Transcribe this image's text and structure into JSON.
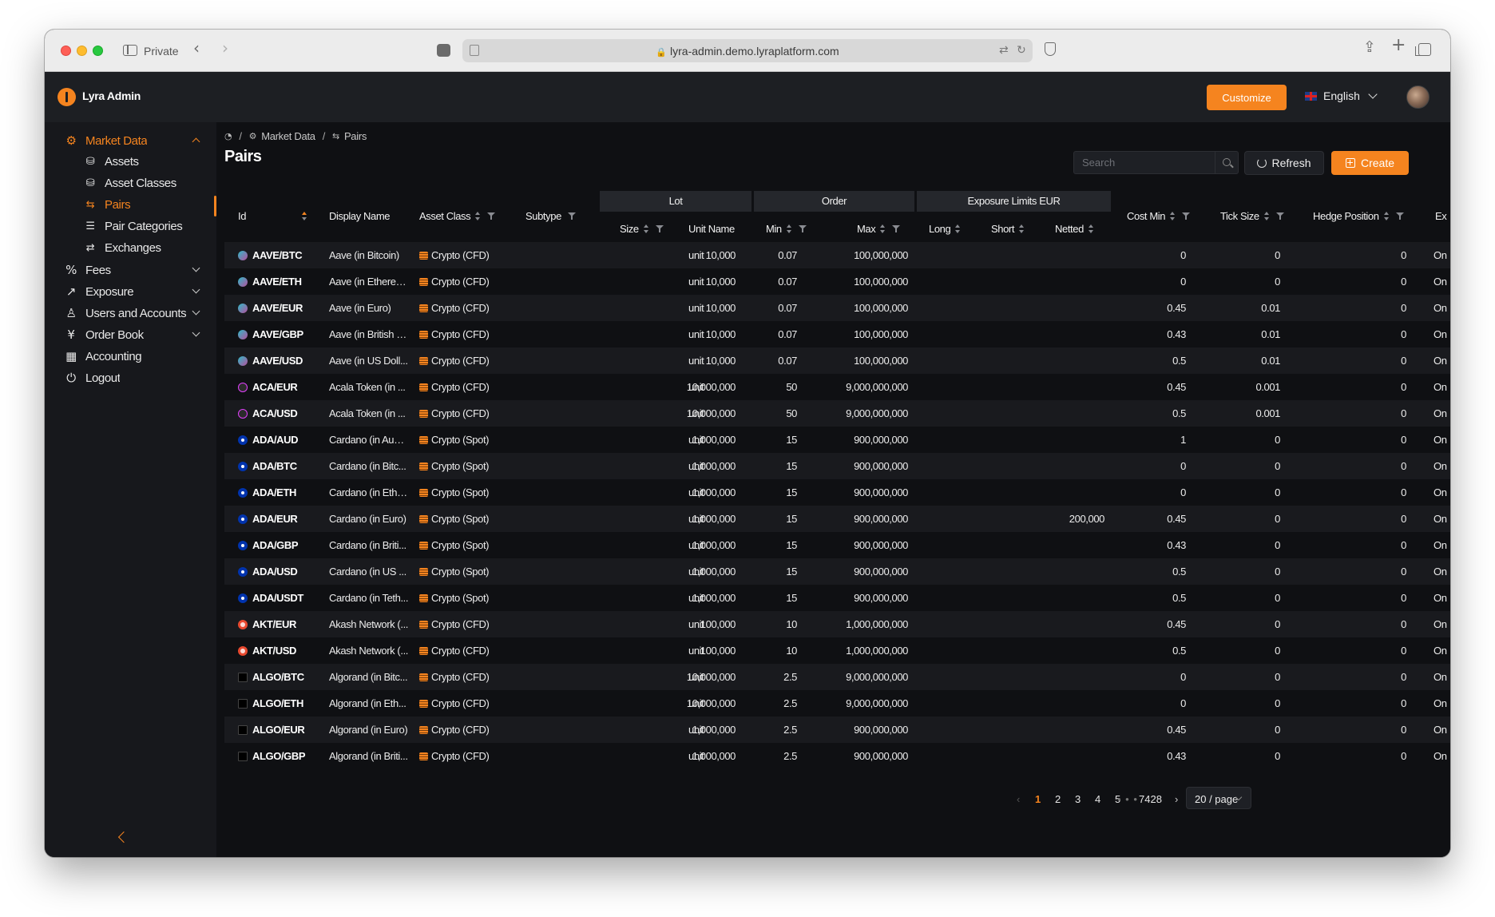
{
  "browser": {
    "private_label": "Private",
    "url": "lyra-admin.demo.lyraplatform.com"
  },
  "header": {
    "brand": "Lyra Admin",
    "customize_label": "Customize",
    "language": "English",
    "accent_color": "#f5841f"
  },
  "sidebar": {
    "items": [
      {
        "label": "Market Data",
        "icon": "gear-icon",
        "expanded": true
      },
      {
        "label": "Assets",
        "icon": "assets-icon"
      },
      {
        "label": "Asset Classes",
        "icon": "asset-classes-icon"
      },
      {
        "label": "Pairs",
        "icon": "swap-icon"
      },
      {
        "label": "Pair Categories",
        "icon": "list-icon"
      },
      {
        "label": "Exchanges",
        "icon": "exchange-icon"
      },
      {
        "label": "Fees",
        "icon": "percent-icon"
      },
      {
        "label": "Exposure",
        "icon": "trend-icon"
      },
      {
        "label": "Users and Accounts",
        "icon": "user-icon"
      },
      {
        "label": "Order Book",
        "icon": "yen-icon"
      },
      {
        "label": "Accounting",
        "icon": "calculator-icon"
      },
      {
        "label": "Logout",
        "icon": "logout-icon"
      }
    ]
  },
  "breadcrumb": {
    "items": [
      "Market Data",
      "Pairs"
    ]
  },
  "page": {
    "title": "Pairs",
    "search_placeholder": "Search",
    "refresh_label": "Refresh",
    "create_label": "Create"
  },
  "table": {
    "group_headers": {
      "lot": "Lot",
      "order": "Order",
      "exposure": "Exposure Limits EUR"
    },
    "columns": {
      "id": "Id",
      "display_name": "Display Name",
      "asset_class": "Asset Class",
      "subtype": "Subtype",
      "lot_size": "Size",
      "unit_name": "Unit Name",
      "order_min": "Min",
      "order_max": "Max",
      "long": "Long",
      "short": "Short",
      "netted": "Netted",
      "cost_min": "Cost Min",
      "tick_size": "Tick Size",
      "hedge_position": "Hedge Position",
      "ex": "Ex"
    },
    "rows": [
      {
        "id": "AAVE/BTC",
        "coin": "aave",
        "name": "Aave (in Bitcoin)",
        "asset_class": "Crypto (CFD)",
        "size": "10,000",
        "unit": "unit",
        "min": "0.07",
        "max": "100,000,000",
        "netted": "",
        "cost_min": "0",
        "tick": "0",
        "hedge": "0",
        "ex": "On"
      },
      {
        "id": "AAVE/ETH",
        "coin": "aave",
        "name": "Aave (in Ethereu...",
        "asset_class": "Crypto (CFD)",
        "size": "10,000",
        "unit": "unit",
        "min": "0.07",
        "max": "100,000,000",
        "netted": "",
        "cost_min": "0",
        "tick": "0",
        "hedge": "0",
        "ex": "On"
      },
      {
        "id": "AAVE/EUR",
        "coin": "aave",
        "name": "Aave (in Euro)",
        "asset_class": "Crypto (CFD)",
        "size": "10,000",
        "unit": "unit",
        "min": "0.07",
        "max": "100,000,000",
        "netted": "",
        "cost_min": "0.45",
        "tick": "0.01",
        "hedge": "0",
        "ex": "On"
      },
      {
        "id": "AAVE/GBP",
        "coin": "aave",
        "name": "Aave (in British P...",
        "asset_class": "Crypto (CFD)",
        "size": "10,000",
        "unit": "unit",
        "min": "0.07",
        "max": "100,000,000",
        "netted": "",
        "cost_min": "0.43",
        "tick": "0.01",
        "hedge": "0",
        "ex": "On"
      },
      {
        "id": "AAVE/USD",
        "coin": "aave",
        "name": "Aave (in US Doll...",
        "asset_class": "Crypto (CFD)",
        "size": "10,000",
        "unit": "unit",
        "min": "0.07",
        "max": "100,000,000",
        "netted": "",
        "cost_min": "0.5",
        "tick": "0.01",
        "hedge": "0",
        "ex": "On"
      },
      {
        "id": "ACA/EUR",
        "coin": "aca",
        "name": "Acala Token (in ...",
        "asset_class": "Crypto (CFD)",
        "size": "10,000,000",
        "unit": "unit",
        "min": "50",
        "max": "9,000,000,000",
        "netted": "",
        "cost_min": "0.45",
        "tick": "0.001",
        "hedge": "0",
        "ex": "On"
      },
      {
        "id": "ACA/USD",
        "coin": "aca",
        "name": "Acala Token (in ...",
        "asset_class": "Crypto (CFD)",
        "size": "10,000,000",
        "unit": "unit",
        "min": "50",
        "max": "9,000,000,000",
        "netted": "",
        "cost_min": "0.5",
        "tick": "0.001",
        "hedge": "0",
        "ex": "On"
      },
      {
        "id": "ADA/AUD",
        "coin": "ada",
        "name": "Cardano (in Aust...",
        "asset_class": "Crypto (Spot)",
        "size": "1,000,000",
        "unit": "unit",
        "min": "15",
        "max": "900,000,000",
        "netted": "",
        "cost_min": "1",
        "tick": "0",
        "hedge": "0",
        "ex": "On"
      },
      {
        "id": "ADA/BTC",
        "coin": "ada",
        "name": "Cardano (in Bitc...",
        "asset_class": "Crypto (Spot)",
        "size": "1,000,000",
        "unit": "unit",
        "min": "15",
        "max": "900,000,000",
        "netted": "",
        "cost_min": "0",
        "tick": "0",
        "hedge": "0",
        "ex": "On"
      },
      {
        "id": "ADA/ETH",
        "coin": "ada",
        "name": "Cardano (in Ethe...",
        "asset_class": "Crypto (Spot)",
        "size": "1,000,000",
        "unit": "unit",
        "min": "15",
        "max": "900,000,000",
        "netted": "",
        "cost_min": "0",
        "tick": "0",
        "hedge": "0",
        "ex": "On"
      },
      {
        "id": "ADA/EUR",
        "coin": "ada",
        "name": "Cardano (in Euro)",
        "asset_class": "Crypto (Spot)",
        "size": "1,000,000",
        "unit": "unit",
        "min": "15",
        "max": "900,000,000",
        "netted": "200,000",
        "cost_min": "0.45",
        "tick": "0",
        "hedge": "0",
        "ex": "On"
      },
      {
        "id": "ADA/GBP",
        "coin": "ada",
        "name": "Cardano (in Briti...",
        "asset_class": "Crypto (Spot)",
        "size": "1,000,000",
        "unit": "unit",
        "min": "15",
        "max": "900,000,000",
        "netted": "",
        "cost_min": "0.43",
        "tick": "0",
        "hedge": "0",
        "ex": "On"
      },
      {
        "id": "ADA/USD",
        "coin": "ada",
        "name": "Cardano (in US ...",
        "asset_class": "Crypto (Spot)",
        "size": "1,000,000",
        "unit": "unit",
        "min": "15",
        "max": "900,000,000",
        "netted": "",
        "cost_min": "0.5",
        "tick": "0",
        "hedge": "0",
        "ex": "On"
      },
      {
        "id": "ADA/USDT",
        "coin": "ada",
        "name": "Cardano (in Teth...",
        "asset_class": "Crypto (Spot)",
        "size": "1,000,000",
        "unit": "unit",
        "min": "15",
        "max": "900,000,000",
        "netted": "",
        "cost_min": "0.5",
        "tick": "0",
        "hedge": "0",
        "ex": "On"
      },
      {
        "id": "AKT/EUR",
        "coin": "akt",
        "name": "Akash Network (...",
        "asset_class": "Crypto (CFD)",
        "size": "100,000",
        "unit": "unit",
        "min": "10",
        "max": "1,000,000,000",
        "netted": "",
        "cost_min": "0.45",
        "tick": "0",
        "hedge": "0",
        "ex": "On"
      },
      {
        "id": "AKT/USD",
        "coin": "akt",
        "name": "Akash Network (...",
        "asset_class": "Crypto (CFD)",
        "size": "100,000",
        "unit": "unit",
        "min": "10",
        "max": "1,000,000,000",
        "netted": "",
        "cost_min": "0.5",
        "tick": "0",
        "hedge": "0",
        "ex": "On"
      },
      {
        "id": "ALGO/BTC",
        "coin": "algo",
        "name": "Algorand (in Bitc...",
        "asset_class": "Crypto (CFD)",
        "size": "10,000,000",
        "unit": "unit",
        "min": "2.5",
        "max": "9,000,000,000",
        "netted": "",
        "cost_min": "0",
        "tick": "0",
        "hedge": "0",
        "ex": "On"
      },
      {
        "id": "ALGO/ETH",
        "coin": "algo",
        "name": "Algorand (in Eth...",
        "asset_class": "Crypto (CFD)",
        "size": "10,000,000",
        "unit": "unit",
        "min": "2.5",
        "max": "9,000,000,000",
        "netted": "",
        "cost_min": "0",
        "tick": "0",
        "hedge": "0",
        "ex": "On"
      },
      {
        "id": "ALGO/EUR",
        "coin": "algo",
        "name": "Algorand (in Euro)",
        "asset_class": "Crypto (CFD)",
        "size": "1,000,000",
        "unit": "unit",
        "min": "2.5",
        "max": "900,000,000",
        "netted": "",
        "cost_min": "0.45",
        "tick": "0",
        "hedge": "0",
        "ex": "On"
      },
      {
        "id": "ALGO/GBP",
        "coin": "algo",
        "name": "Algorand (in Briti...",
        "asset_class": "Crypto (CFD)",
        "size": "1,000,000",
        "unit": "unit",
        "min": "2.5",
        "max": "900,000,000",
        "netted": "",
        "cost_min": "0.43",
        "tick": "0",
        "hedge": "0",
        "ex": "On"
      }
    ]
  },
  "pagination": {
    "pages": [
      "1",
      "2",
      "3",
      "4",
      "5"
    ],
    "current": "1",
    "ellipsis": "• • •",
    "last": "7428",
    "page_size": "20 / page"
  }
}
